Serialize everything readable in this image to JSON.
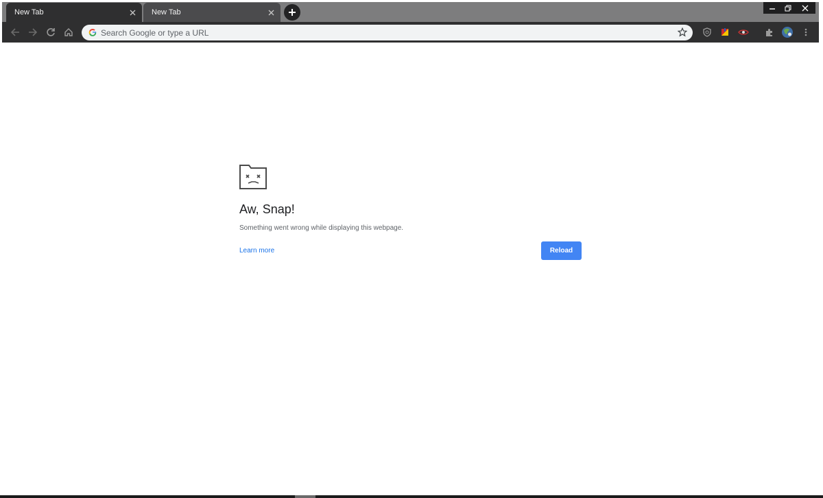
{
  "tabs": [
    {
      "label": "New Tab",
      "active": true
    },
    {
      "label": "New Tab",
      "active": false
    }
  ],
  "window_controls": {
    "minimize_icon": "minimize-icon",
    "restore_icon": "restore-icon",
    "close_icon": "close-icon"
  },
  "toolbar": {
    "icons": [
      "back-icon",
      "forward-icon",
      "reload-icon",
      "home-icon",
      "bookmark-star-icon",
      "shield-extension-icon",
      "color-extension-icon",
      "eye-extension-icon",
      "puzzle-extensions-icon",
      "profile-avatar-icon",
      "more-menu-icon"
    ]
  },
  "omnibox": {
    "placeholder": "Search Google or type a URL",
    "value": ""
  },
  "error_page": {
    "icon": "sad-tab-icon",
    "title": "Aw, Snap!",
    "message": "Something went wrong while displaying this webpage.",
    "learn_more": "Learn more",
    "reload_label": "Reload"
  },
  "colors": {
    "tabstrip": "#7d7d7e",
    "toolbar": "#2f2f30",
    "omnibox": "#f1f3f4",
    "link": "#1a73e8",
    "button": "#4285f4"
  }
}
